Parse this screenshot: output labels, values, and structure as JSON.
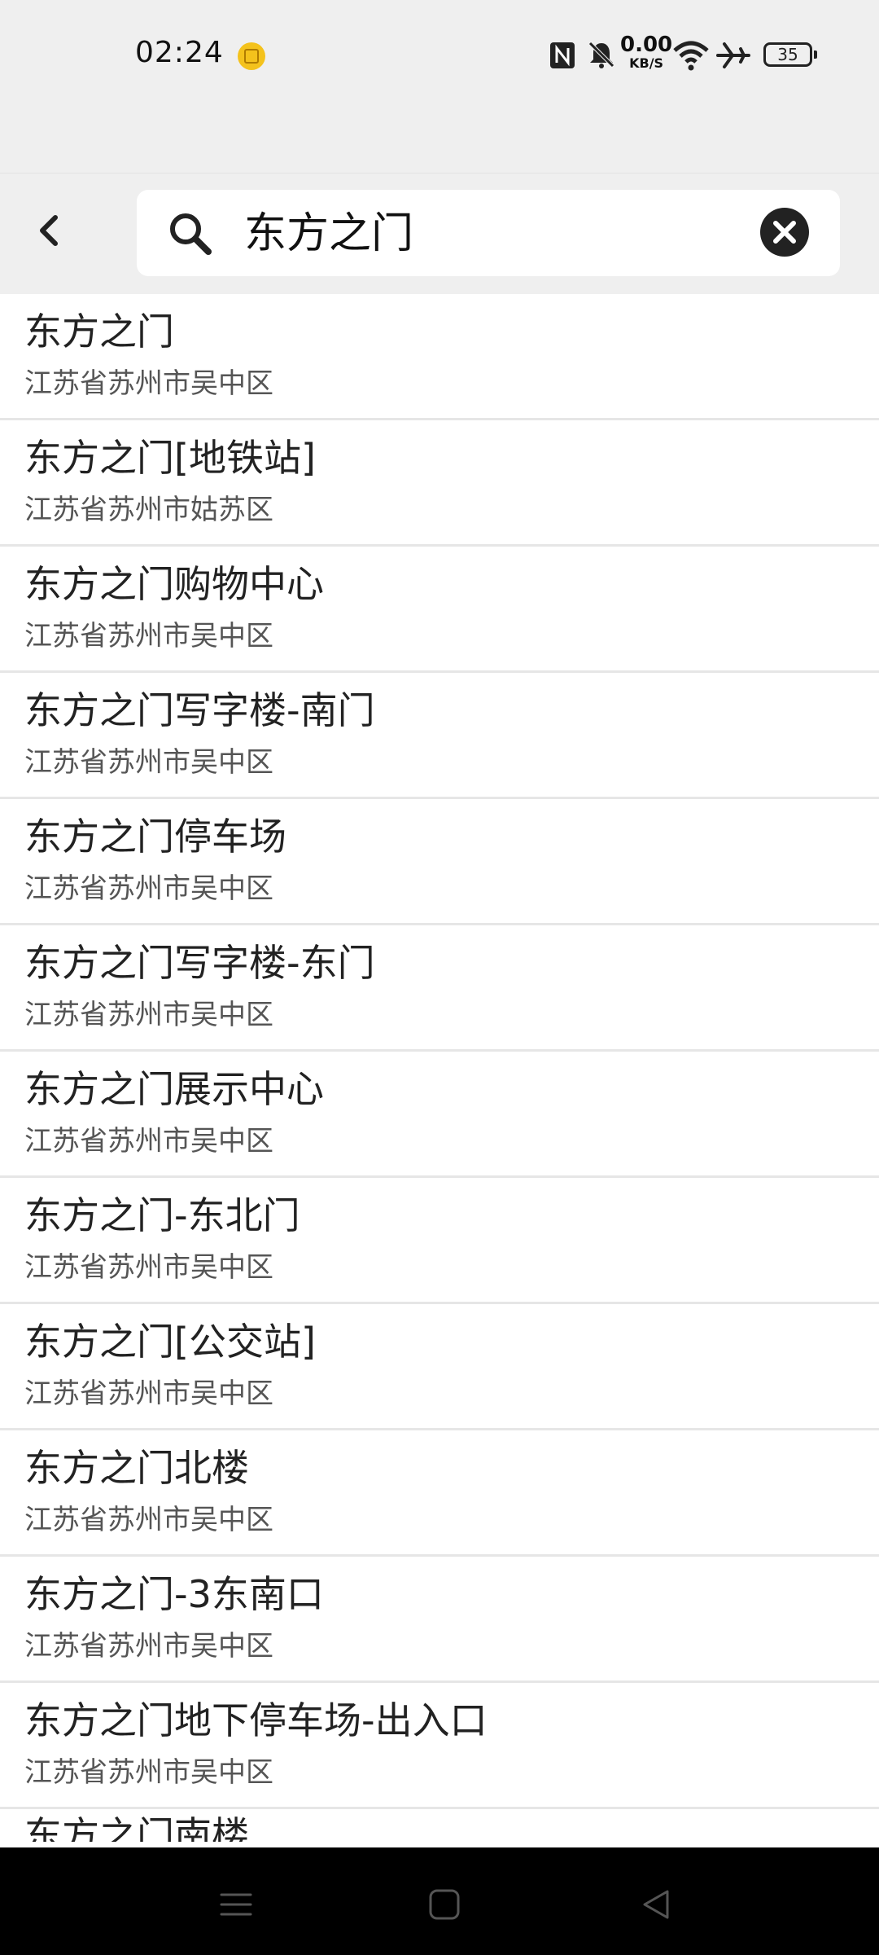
{
  "status_bar": {
    "time": "02:24",
    "net_speed_value": "0.00",
    "net_speed_unit": "KB/S",
    "battery_level": "35"
  },
  "search": {
    "query": "东方之门"
  },
  "results": [
    {
      "title": "东方之门",
      "subtitle": "江苏省苏州市吴中区"
    },
    {
      "title": "东方之门[地铁站]",
      "subtitle": "江苏省苏州市姑苏区"
    },
    {
      "title": "东方之门购物中心",
      "subtitle": "江苏省苏州市吴中区"
    },
    {
      "title": "东方之门写字楼-南门",
      "subtitle": "江苏省苏州市吴中区"
    },
    {
      "title": "东方之门停车场",
      "subtitle": "江苏省苏州市吴中区"
    },
    {
      "title": "东方之门写字楼-东门",
      "subtitle": "江苏省苏州市吴中区"
    },
    {
      "title": "东方之门展示中心",
      "subtitle": "江苏省苏州市吴中区"
    },
    {
      "title": "东方之门-东北门",
      "subtitle": "江苏省苏州市吴中区"
    },
    {
      "title": "东方之门[公交站]",
      "subtitle": "江苏省苏州市吴中区"
    },
    {
      "title": "东方之门北楼",
      "subtitle": "江苏省苏州市吴中区"
    },
    {
      "title": "东方之门-3东南口",
      "subtitle": "江苏省苏州市吴中区"
    },
    {
      "title": "东方之门地下停车场-出入口",
      "subtitle": "江苏省苏州市吴中区"
    }
  ],
  "partial_result": {
    "title": "东方之门南楼"
  },
  "icons": {
    "back": "chevron-left-icon",
    "search": "search-icon",
    "clear": "close-circle-icon",
    "nav_menu": "menu-icon",
    "nav_home": "home-square-icon",
    "nav_back": "back-triangle-icon"
  }
}
